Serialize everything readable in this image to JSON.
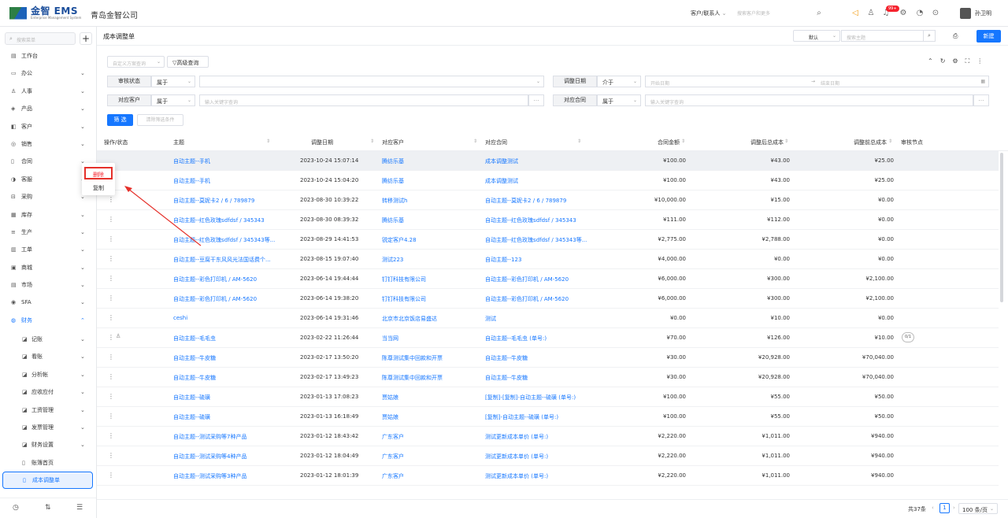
{
  "app": {
    "logo_text": "金智 EMS",
    "logo_sub": "Enterprise Management System",
    "company": "青岛金智公司",
    "top_search_type": "客户/联系人",
    "top_search_placeholder": "搜索客户和更多",
    "badge": "99+",
    "username": "孙卫明"
  },
  "sidebar": {
    "search_placeholder": "搜索菜单",
    "plus": "+",
    "items": [
      {
        "icon": "▤",
        "label": "工作台"
      },
      {
        "icon": "▭",
        "label": "办公"
      },
      {
        "icon": "♙",
        "label": "人事"
      },
      {
        "icon": "◈",
        "label": "产品"
      },
      {
        "icon": "◧",
        "label": "客户"
      },
      {
        "icon": "◎",
        "label": "销售"
      },
      {
        "icon": "▯",
        "label": "合同"
      },
      {
        "icon": "◑",
        "label": "客服"
      },
      {
        "icon": "⊟",
        "label": "采购"
      },
      {
        "icon": "▦",
        "label": "库存"
      },
      {
        "icon": "≡",
        "label": "生产"
      },
      {
        "icon": "▥",
        "label": "工单"
      },
      {
        "icon": "▣",
        "label": "商城"
      },
      {
        "icon": "▤",
        "label": "市场"
      },
      {
        "icon": "◉",
        "label": "SFA"
      },
      {
        "icon": "◍",
        "label": "财务"
      }
    ],
    "subitems": [
      {
        "icon": "◪",
        "label": "记账"
      },
      {
        "icon": "◪",
        "label": "看账"
      },
      {
        "icon": "◪",
        "label": "分析帐"
      },
      {
        "icon": "◪",
        "label": "应收应付"
      },
      {
        "icon": "◪",
        "label": "工资管理"
      },
      {
        "icon": "◪",
        "label": "发票管理"
      },
      {
        "icon": "◪",
        "label": "财务设置"
      },
      {
        "icon": "▯",
        "label": "账簿首页"
      },
      {
        "icon": "▯",
        "label": "成本调整单"
      }
    ]
  },
  "main": {
    "title": "成本调整单",
    "view_select": "默认",
    "title_search_placeholder": "搜索主题",
    "new_button": "新建",
    "filter_scheme_placeholder": "自定义方案查询",
    "advanced_search": "高级查询",
    "filters": {
      "audit_status": {
        "label": "审核状态",
        "op": "属于",
        "value": ""
      },
      "adjust_date": {
        "label": "调整日期",
        "op": "介于",
        "start": "开始日期",
        "end": "结束日期"
      },
      "customer": {
        "label": "对应客户",
        "op": "属于",
        "placeholder": "输入关键字查询"
      },
      "contract": {
        "label": "对应合同",
        "op": "属于",
        "placeholder": "输入关键字查询"
      }
    },
    "filter_button": "筛 选",
    "clear_button": "清除筛选条件"
  },
  "table": {
    "headers": [
      "操作/状态",
      "主题",
      "调整日期",
      "对应客户",
      "对应合同",
      "合同金额",
      "调整后总成本",
      "调整前总成本",
      "审核节点"
    ],
    "rows": [
      {
        "subject": "自动主题--手机",
        "date": "2023-10-24 15:07:14",
        "customer": "腾纺乐基",
        "contract": "成本调整测试",
        "amount": "¥100.00",
        "after": "¥43.00",
        "before": "¥25.00",
        "node": ""
      },
      {
        "subject": "自动主题--手机",
        "date": "2023-10-24 15:04:20",
        "customer": "腾纺乐基",
        "contract": "成本调整测试",
        "amount": "¥100.00",
        "after": "¥43.00",
        "before": "¥25.00",
        "node": ""
      },
      {
        "subject": "自动主题--莫妮卡2 / 6 / 789879",
        "date": "2023-08-30 10:39:22",
        "customer": "转移测试h",
        "contract": "自动主题--莫妮卡2 / 6 / 789879",
        "amount": "¥10,000.00",
        "after": "¥15.00",
        "before": "¥0.00",
        "node": ""
      },
      {
        "subject": "自动主题--红色玫瑰sdfdsf / 345343",
        "date": "2023-08-30 08:39:32",
        "customer": "腾纺乐基",
        "contract": "自动主题--红色玫瑰sdfdsf / 345343",
        "amount": "¥111.00",
        "after": "¥112.00",
        "before": "¥0.00",
        "node": ""
      },
      {
        "subject": "自动主题--红色玫瑰sdfdsf / 345343等...",
        "date": "2023-08-29 14:41:53",
        "customer": "锐定客户4.28",
        "contract": "自动主题--红色玫瑰sdfdsf / 345343等...",
        "amount": "¥2,775.00",
        "after": "¥2,788.00",
        "before": "¥0.00",
        "node": ""
      },
      {
        "subject": "自动主题--豆腐干东风风光法国话费个...",
        "date": "2023-08-15 19:07:40",
        "customer": "测试223",
        "contract": "自动主题--123",
        "amount": "¥4,000.00",
        "after": "¥0.00",
        "before": "¥0.00",
        "node": ""
      },
      {
        "subject": "自动主题--彩色打印机 / AM-5620",
        "date": "2023-06-14 19:44:44",
        "customer": "钉钉科技有限公司",
        "contract": "自动主题--彩色打印机 / AM-5620",
        "amount": "¥6,000.00",
        "after": "¥300.00",
        "before": "¥2,100.00",
        "node": ""
      },
      {
        "subject": "自动主题--彩色打印机 / AM-5620",
        "date": "2023-06-14 19:38:20",
        "customer": "钉钉科技有限公司",
        "contract": "自动主题--彩色打印机 / AM-5620",
        "amount": "¥6,000.00",
        "after": "¥300.00",
        "before": "¥2,100.00",
        "node": ""
      },
      {
        "subject": "ceshi",
        "date": "2023-06-14 19:31:46",
        "customer": "北京市北京饭店易盛达",
        "contract": "测试",
        "amount": "¥0.00",
        "after": "¥10.00",
        "before": "¥0.00",
        "node": ""
      },
      {
        "subject": "自动主题--毛毛虫",
        "date": "2023-02-22 11:26:44",
        "customer": "当当网",
        "contract": "自动主题--毛毛虫 (单号:)",
        "amount": "¥70.00",
        "after": "¥126.00",
        "before": "¥10.00",
        "node": "0/1"
      },
      {
        "subject": "自动主题--牛皮糖",
        "date": "2023-02-17 13:50:20",
        "customer": "陈尊测试集中回款和开票",
        "contract": "自动主题--牛皮糖",
        "amount": "¥30.00",
        "after": "¥20,928.00",
        "before": "¥70,040.00",
        "node": ""
      },
      {
        "subject": "自动主题--牛皮糖",
        "date": "2023-02-17 13:49:23",
        "customer": "陈尊测试集中回款和开票",
        "contract": "自动主题--牛皮糖",
        "amount": "¥30.00",
        "after": "¥20,928.00",
        "before": "¥70,040.00",
        "node": ""
      },
      {
        "subject": "自动主题--硫磺",
        "date": "2023-01-13 17:08:23",
        "customer": "贾姑娘",
        "contract": "[复制]-[复制]-自动主题--硫磺 (单号:)",
        "amount": "¥100.00",
        "after": "¥55.00",
        "before": "¥50.00",
        "node": ""
      },
      {
        "subject": "自动主题--硫磺",
        "date": "2023-01-13 16:18:49",
        "customer": "贾姑娘",
        "contract": "[复制]-自动主题--硫磺 (单号:)",
        "amount": "¥100.00",
        "after": "¥55.00",
        "before": "¥50.00",
        "node": ""
      },
      {
        "subject": "自动主题--测试采购等7种产品",
        "date": "2023-01-12 18:43:42",
        "customer": "广东客户",
        "contract": "测试更新成本单价 (单号:)",
        "amount": "¥2,220.00",
        "after": "¥1,011.00",
        "before": "¥940.00",
        "node": ""
      },
      {
        "subject": "自动主题--测试采购等4种产品",
        "date": "2023-01-12 18:04:49",
        "customer": "广东客户",
        "contract": "测试更新成本单价 (单号:)",
        "amount": "¥2,220.00",
        "after": "¥1,011.00",
        "before": "¥940.00",
        "node": ""
      },
      {
        "subject": "自动主题--测试采购等3种产品",
        "date": "2023-01-12 18:01:39",
        "customer": "广东客户",
        "contract": "测试更新成本单价 (单号:)",
        "amount": "¥2,220.00",
        "after": "¥1,011.00",
        "before": "¥940.00",
        "node": ""
      }
    ]
  },
  "context_menu": {
    "delete": "删除",
    "copy": "复制"
  },
  "footer": {
    "total": "共37条",
    "page": "1",
    "page_size": "100 条/页"
  },
  "colors": {
    "accent": "#1677ff",
    "danger": "#e5302a"
  }
}
